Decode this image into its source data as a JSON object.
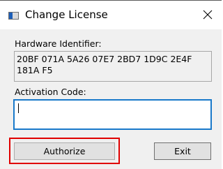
{
  "window": {
    "title": "Change License",
    "close_glyph": "✕"
  },
  "hardware": {
    "label": "Hardware Identifier:",
    "value": "20BF 071A 5A26 07E7 2BD7 1D9C 2E4F 181A F5"
  },
  "activation": {
    "label": "Activation Code:",
    "value": "",
    "placeholder": ""
  },
  "buttons": {
    "authorize_label": "Authorize",
    "exit_label": "Exit"
  },
  "colors": {
    "highlight": "#e00000",
    "focus_border": "#1979ca",
    "dialog_background": "#f0f0f0"
  },
  "icons": {
    "app": "window-icon",
    "close": "close-icon"
  }
}
